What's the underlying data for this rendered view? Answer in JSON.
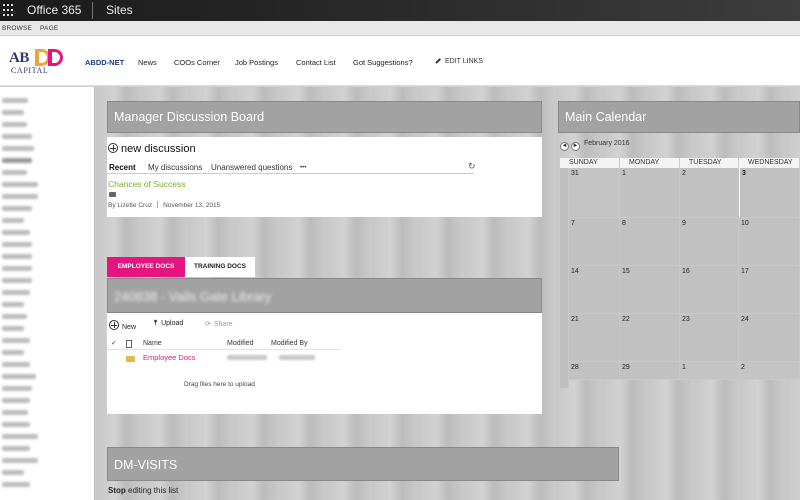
{
  "suite": {
    "title": "Office 365",
    "sites": "Sites"
  },
  "ribbon": {
    "browse": "BROWSE",
    "page": "PAGE"
  },
  "logo": {
    "ab": "AB",
    "capital": "CAPITAL"
  },
  "nav": {
    "items": [
      "ABDD-NET",
      "News",
      "COOs Corner",
      "Job Postings",
      "Contact List",
      "Got Suggestions?"
    ],
    "edit_links": "EDIT LINKS"
  },
  "discussion": {
    "header": "Manager Discussion Board",
    "new_label": "new discussion",
    "tabs": [
      "Recent",
      "My discussions",
      "Unanswered questions",
      "•••"
    ],
    "post_title": "Chances of Success",
    "post_author": "By Lizette Cruz",
    "post_date": "November 13, 2015"
  },
  "library": {
    "tabs": [
      "EMPLOYEE DOCS",
      "TRAINING DOCS"
    ],
    "header": "240838 - Vails Gate Library",
    "commands": {
      "new": "New",
      "upload": "Upload",
      "share": "Share"
    },
    "columns": [
      "✓",
      "Name",
      "Modified",
      "Modified By"
    ],
    "rows": [
      {
        "name": "Employee Docs"
      }
    ],
    "drag_text": "Drag files here to upload"
  },
  "calendar": {
    "header": "Main Calendar",
    "month": "February 2016",
    "prev": "◄",
    "next": "►",
    "daynames": [
      "SUNDAY",
      "MONDAY",
      "TUESDAY",
      "WEDNESDAY"
    ],
    "weeks": [
      [
        "31",
        "1",
        "2",
        "3"
      ],
      [
        "7",
        "8",
        "9",
        "10"
      ],
      [
        "14",
        "15",
        "16",
        "17"
      ],
      [
        "21",
        "22",
        "23",
        "24"
      ],
      [
        "28",
        "29",
        "1",
        "2"
      ]
    ]
  },
  "visits": {
    "header": "DM-VISITS",
    "stop_bold": "Stop",
    "stop_rest": " editing this list"
  },
  "colors": {
    "accent_pink": "#e4157f",
    "link_green": "#7aaf2c",
    "nav_blue": "#1a3a8a"
  }
}
